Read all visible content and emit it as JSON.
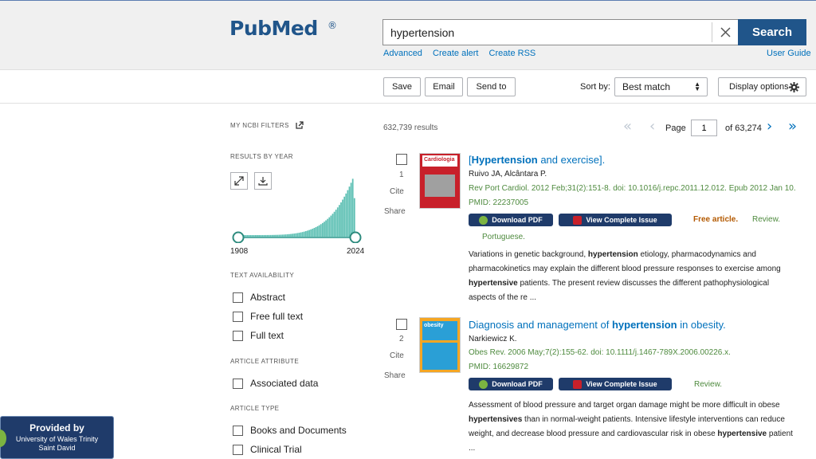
{
  "header": {
    "logo_text": "PubMed",
    "logo_reg": "®",
    "search_value": "hypertension",
    "search_label": "Search",
    "links": [
      "Advanced",
      "Create alert",
      "Create RSS"
    ],
    "user_guide": "User Guide"
  },
  "toolbar": {
    "save": "Save",
    "email": "Email",
    "send_to": "Send to",
    "sort_by_label": "Sort by:",
    "sort_value": "Best match",
    "display_options": "Display options"
  },
  "sidebar": {
    "ncbi_filters": "MY NCBI FILTERS",
    "results_by_year": "RESULTS BY YEAR",
    "year_start": "1908",
    "year_end": "2024",
    "text_availability": "TEXT AVAILABILITY",
    "text_items": [
      "Abstract",
      "Free full text",
      "Full text"
    ],
    "article_attribute": "ARTICLE ATTRIBUTE",
    "attribute_items": [
      "Associated data"
    ],
    "article_type": "ARTICLE TYPE",
    "type_items": [
      "Books and Documents",
      "Clinical Trial"
    ]
  },
  "results": {
    "count": "632,739 results",
    "page_label": "Page",
    "page_value": "1",
    "of_pages": "of 63,274",
    "articles": [
      {
        "num": "1",
        "cite": "Cite",
        "share": "Share",
        "title_pre": "[",
        "title_bold": "Hypertension",
        "title_post": " and exercise].",
        "authors": "Ruivo JA, Alcântara P.",
        "citation": "Rev Port Cardiol. 2012 Feb;31(2):151-8. doi: 10.1016/j.repc.2011.12.012. Epub 2012 Jan 10.",
        "pmid": "PMID: 22237005",
        "download_pdf": "Download PDF",
        "view_issue": "View Complete Issue",
        "free": "Free article.",
        "review": "Review.",
        "language": "Portuguese.",
        "snip": [
          [
            "Variations in genetic background, ",
            "hypertension",
            " etiology, pharmacodynamics and"
          ],
          [
            "pharmacokinetics may explain the different blood pressure responses to exercise among",
            "",
            ""
          ],
          [
            "",
            "hypertensive",
            " patients. The present review discusses the different pathophysiological"
          ],
          [
            "aspects of the re ...",
            "",
            ""
          ]
        ],
        "cover_title": "Cardiologia"
      },
      {
        "num": "2",
        "cite": "Cite",
        "share": "Share",
        "title_pre": "Diagnosis and management of ",
        "title_bold": "hypertension",
        "title_post": " in obesity.",
        "authors": "Narkiewicz K.",
        "citation": "Obes Rev. 2006 May;7(2):155-62. doi: 10.1111/j.1467-789X.2006.00226.x.",
        "pmid": "PMID: 16629872",
        "download_pdf": "Download PDF",
        "view_issue": "View Complete Issue",
        "review": "Review.",
        "snip": [
          [
            "Assessment of blood pressure and target organ damage might be more difficult in obese",
            "",
            ""
          ],
          [
            "",
            "hypertensives",
            " than in normal-weight patients. Intensive lifestyle interventions can reduce"
          ],
          [
            "weight, and decrease blood pressure and cardiovascular risk in obese ",
            "hypertensive",
            " patient"
          ],
          [
            "...",
            "",
            ""
          ]
        ],
        "cover_title": "obesity"
      }
    ]
  },
  "provided": {
    "title": "Provided by",
    "line1": "University of Wales Trinity",
    "line2": "Saint David"
  },
  "colors": {
    "brand": "#20558a",
    "link": "#0071bc",
    "citation_green": "#4e8a3e",
    "free_orange": "#b35900",
    "pill_navy": "#1f3b6a"
  }
}
